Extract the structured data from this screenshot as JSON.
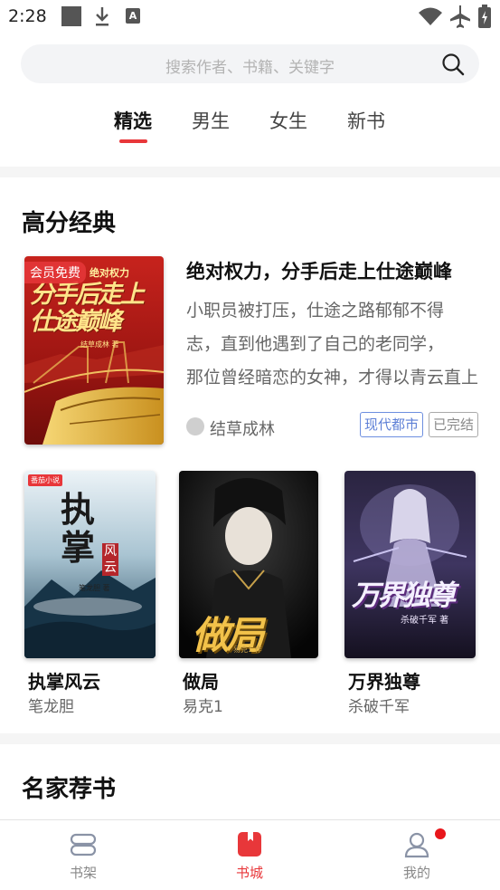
{
  "status_bar": {
    "time": "2:28",
    "icons": [
      "notification-square-icon",
      "download-icon",
      "a-app-icon",
      "wifi-icon",
      "airplane-icon",
      "battery-icon"
    ]
  },
  "search": {
    "placeholder": "搜索作者、书籍、关键字",
    "icon": "search-icon"
  },
  "tabs": [
    {
      "label": "精选",
      "active": true
    },
    {
      "label": "男生",
      "active": false
    },
    {
      "label": "女生",
      "active": false
    },
    {
      "label": "新书",
      "active": false
    }
  ],
  "sections": {
    "high_score": "高分经典",
    "famous": "名家荐书"
  },
  "featured": {
    "badge": "会员免费",
    "cover_text": "分手后走上仕途巅峰",
    "cover_small": "绝对权力",
    "cover_author": "结草成林 著",
    "title": "绝对权力，分手后走上仕途巅峰",
    "desc_lines": [
      "小职员被打压，仕途之路郁郁不得",
      "志，直到他遇到了自己的老同学，",
      "那位曾经暗恋的女神，才得以青云直上"
    ],
    "author": "结草成林",
    "tags": [
      "现代都市",
      "已完结"
    ]
  },
  "books": [
    {
      "title": "执掌风云",
      "author": "笔龙胆",
      "cover_title": "执掌",
      "cover_sub": "风云",
      "cover_brand": "番茄小说",
      "cover_author": "笔龙胆 著"
    },
    {
      "title": "做局",
      "author": "易克1",
      "cover_title": "做局",
      "cover_author": "易克1 作"
    },
    {
      "title": "万界独尊",
      "author": "杀破千军",
      "cover_title": "万界独尊",
      "cover_author": "杀破千军 著"
    }
  ],
  "bottom_nav": [
    {
      "label": "书架",
      "icon": "bookshelf-icon",
      "active": false
    },
    {
      "label": "书城",
      "icon": "bookstore-icon",
      "active": true
    },
    {
      "label": "我的",
      "icon": "profile-icon",
      "active": false
    }
  ],
  "colors": {
    "accent": "#e8373a",
    "tag_genre": "#5d7fd6",
    "tag_status": "#8a8a8a",
    "notification_dot": "#e8161b"
  }
}
